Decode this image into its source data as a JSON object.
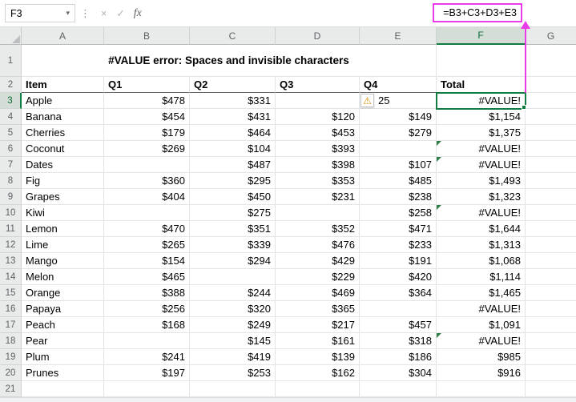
{
  "formula_bar": {
    "name_box": "F3",
    "formula": "=B3+C3+D3+E3"
  },
  "icons": {
    "dropdown": "▾",
    "menu_dots": "⋮",
    "cancel": "×",
    "enter": "✓",
    "fx": "fx",
    "warning": "⚠"
  },
  "grid": {
    "columns": [
      "A",
      "B",
      "C",
      "D",
      "E",
      "F",
      "G"
    ],
    "row_numbers": [
      1,
      2,
      3,
      4,
      5,
      6,
      7,
      8,
      9,
      10,
      11,
      12,
      13,
      14,
      15,
      16,
      17,
      18,
      19,
      20,
      21
    ],
    "selected_cell": "F3",
    "selected_column": "F",
    "selected_row": 3
  },
  "sheet": {
    "title": "#VALUE error: Spaces and invisible characters",
    "headers": {
      "item": "Item",
      "q1": "Q1",
      "q2": "Q2",
      "q3": "Q3",
      "q4": "Q4",
      "total": "Total"
    },
    "data": [
      {
        "row": 3,
        "item": "Apple",
        "q1": "$478",
        "q2": "$331",
        "q3": "",
        "q4": "25",
        "total": "#VALUE!",
        "q4_warning": true,
        "selected": true
      },
      {
        "row": 4,
        "item": "Banana",
        "q1": "$454",
        "q2": "$431",
        "q3": "$120",
        "q4": "$149",
        "total": "$1,154"
      },
      {
        "row": 5,
        "item": "Cherries",
        "q1": "$179",
        "q2": "$464",
        "q3": "$453",
        "q4": "$279",
        "total": "$1,375"
      },
      {
        "row": 6,
        "item": "Coconut",
        "q1": "$269",
        "q2": "$104",
        "q3": "$393",
        "q4": "",
        "total": "#VALUE!",
        "error_mark": true
      },
      {
        "row": 7,
        "item": "Dates",
        "q1": "",
        "q2": "$487",
        "q3": "$398",
        "q4": "$107",
        "total": "#VALUE!",
        "error_mark": true
      },
      {
        "row": 8,
        "item": "Fig",
        "q1": "$360",
        "q2": "$295",
        "q3": "$353",
        "q4": "$485",
        "total": "$1,493"
      },
      {
        "row": 9,
        "item": "Grapes",
        "q1": "$404",
        "q2": "$450",
        "q3": "$231",
        "q4": "$238",
        "total": "$1,323"
      },
      {
        "row": 10,
        "item": "Kiwi",
        "q1": "",
        "q2": "$275",
        "q3": "",
        "q4": "$258",
        "total": "#VALUE!",
        "error_mark": true
      },
      {
        "row": 11,
        "item": "Lemon",
        "q1": "$470",
        "q2": "$351",
        "q3": "$352",
        "q4": "$471",
        "total": "$1,644"
      },
      {
        "row": 12,
        "item": "Lime",
        "q1": "$265",
        "q2": "$339",
        "q3": "$476",
        "q4": "$233",
        "total": "$1,313"
      },
      {
        "row": 13,
        "item": "Mango",
        "q1": "$154",
        "q2": "$294",
        "q3": "$429",
        "q4": "$191",
        "total": "$1,068"
      },
      {
        "row": 14,
        "item": "Melon",
        "q1": "$465",
        "q2": "",
        "q3": "$229",
        "q4": "$420",
        "total": "$1,114"
      },
      {
        "row": 15,
        "item": "Orange",
        "q1": "$388",
        "q2": "$244",
        "q3": "$469",
        "q4": "$364",
        "total": "$1,465"
      },
      {
        "row": 16,
        "item": "Papaya",
        "q1": "$256",
        "q2": "$320",
        "q3": "$365",
        "q4": "",
        "total": "#VALUE!"
      },
      {
        "row": 17,
        "item": "Peach",
        "q1": "$168",
        "q2": "$249",
        "q3": "$217",
        "q4": "$457",
        "total": "$1,091"
      },
      {
        "row": 18,
        "item": "Pear",
        "q1": "",
        "q2": "$145",
        "q3": "$161",
        "q4": "$318",
        "total": "#VALUE!",
        "error_mark": true
      },
      {
        "row": 19,
        "item": "Plum",
        "q1": "$241",
        "q2": "$419",
        "q3": "$139",
        "q4": "$186",
        "total": "$985"
      },
      {
        "row": 20,
        "item": "Prunes",
        "q1": "$197",
        "q2": "$253",
        "q3": "$162",
        "q4": "$304",
        "total": "$916"
      }
    ]
  },
  "colors": {
    "selection": "#107C41",
    "highlight": "#E93BE9",
    "error-mark": "#2E7D46",
    "warning": "#DE8D00"
  }
}
